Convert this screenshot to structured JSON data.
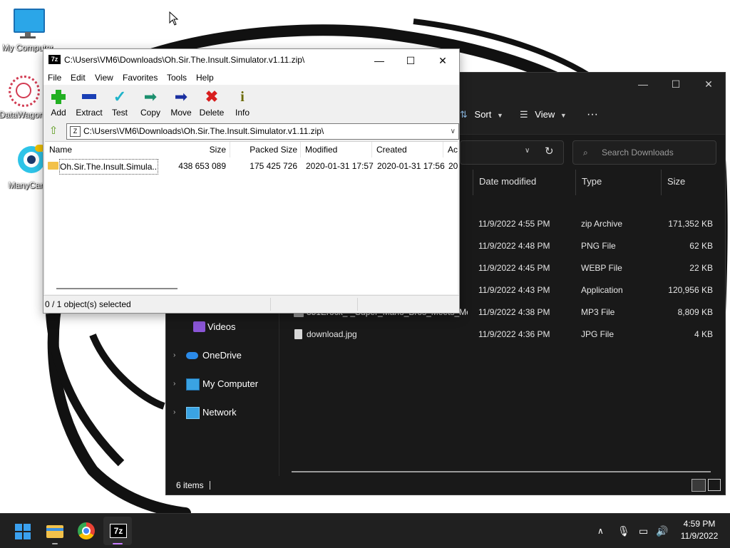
{
  "desktop": {
    "icons": [
      {
        "label": "My Computer",
        "icon": "monitor-icon"
      },
      {
        "label": "DataWagon",
        "icon": "datawagon-icon"
      },
      {
        "label": "ManyCam",
        "icon": "manycam-icon"
      }
    ]
  },
  "explorer": {
    "window_controls": {
      "minimize": "—",
      "maximize": "☐",
      "close": "✕"
    },
    "command_bar": {
      "sort_label": "Sort",
      "view_label": "View",
      "more_label": "···"
    },
    "search_placeholder": "Search Downloads",
    "nav": [
      {
        "label": "Videos",
        "icon": "videos-icon",
        "expandable": false
      },
      {
        "label": "OneDrive",
        "icon": "onedrive-icon",
        "expandable": true
      },
      {
        "label": "My Computer",
        "icon": "computer-icon",
        "expandable": true
      },
      {
        "label": "Network",
        "icon": "network-icon",
        "expandable": true
      }
    ],
    "columns": {
      "date_modified": "Date modified",
      "type": "Type",
      "size": "Size"
    },
    "rows": [
      {
        "name": "",
        "date": "11/9/2022 4:55 PM",
        "type": "zip Archive",
        "size": "171,352 KB"
      },
      {
        "name": "",
        "date": "11/9/2022 4:48 PM",
        "type": "PNG File",
        "size": "62 KB"
      },
      {
        "name": "",
        "date": "11/9/2022 4:45 PM",
        "type": "WEBP File",
        "size": "22 KB"
      },
      {
        "name": "",
        "date": "11/9/2022 4:43 PM",
        "type": "Application",
        "size": "120,956 KB"
      },
      {
        "name": "351Erock_-_Super_Mario_Bros_Meets_Me...",
        "date": "11/9/2022 4:38 PM",
        "type": "MP3 File",
        "size": "8,809 KB"
      },
      {
        "name": "download.jpg",
        "date": "11/9/2022 4:36 PM",
        "type": "JPG File",
        "size": "4 KB"
      }
    ],
    "status": "6 items"
  },
  "zip": {
    "title": "C:\\Users\\VM6\\Downloads\\Oh.Sir.The.Insult.Simulator.v1.11.zip\\",
    "app_badge": "7z",
    "window_controls": {
      "minimize": "—",
      "maximize": "☐",
      "close": "✕"
    },
    "menu": [
      "File",
      "Edit",
      "View",
      "Favorites",
      "Tools",
      "Help"
    ],
    "toolbar": {
      "add": "Add",
      "extract": "Extract",
      "test": "Test",
      "copy": "Copy",
      "move": "Move",
      "delete": "Delete",
      "info": "Info"
    },
    "path": "C:\\Users\\VM6\\Downloads\\Oh.Sir.The.Insult.Simulator.v1.11.zip\\",
    "columns": {
      "name": "Name",
      "size": "Size",
      "packed": "Packed Size",
      "modified": "Modified",
      "created": "Created",
      "accessed": "Ac"
    },
    "items": [
      {
        "name": "Oh.Sir.The.Insult.Simula...",
        "size": "438 653 089",
        "packed": "175 425 726",
        "modified": "2020-01-31 17:57",
        "created": "2020-01-31 17:56",
        "accessed": "20"
      }
    ],
    "status": "0 / 1 object(s) selected"
  },
  "taskbar": {
    "apps": [
      "windows-start-icon",
      "file-explorer-icon",
      "chrome-icon",
      "7zip-icon"
    ],
    "time": "4:59 PM",
    "date": "11/9/2022"
  }
}
